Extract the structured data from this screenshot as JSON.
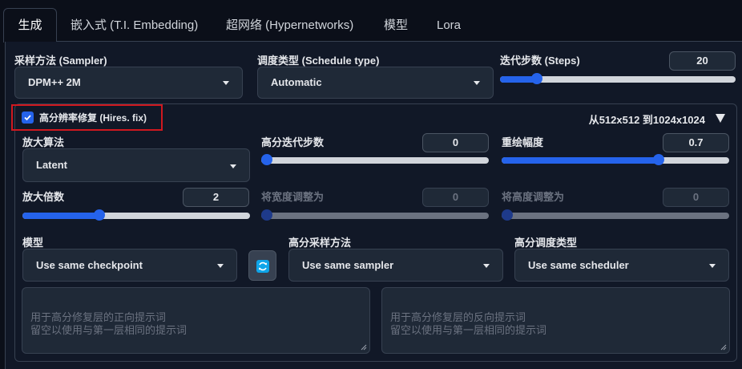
{
  "tabs": [
    {
      "label": "生成",
      "active": true
    },
    {
      "label": "嵌入式 (T.I. Embedding)"
    },
    {
      "label": "超网络 (Hypernetworks)"
    },
    {
      "label": "模型"
    },
    {
      "label": "Lora"
    }
  ],
  "sampler": {
    "label": "采样方法 (Sampler)",
    "value": "DPM++ 2M"
  },
  "schedule": {
    "label": "调度类型 (Schedule type)",
    "value": "Automatic"
  },
  "steps": {
    "label": "迭代步数 (Steps)",
    "value": "20",
    "fraction": 0.14
  },
  "hires": {
    "checkbox_label": "高分辨率修复 (Hires. fix)",
    "checked": true,
    "resolution_info": "从512x512 到1024x1024",
    "upscaler": {
      "label": "放大算法",
      "value": "Latent"
    },
    "hires_steps": {
      "label": "高分迭代步数",
      "value": "0",
      "fraction": 0.0
    },
    "denoising": {
      "label": "重绘幅度",
      "value": "0.7",
      "fraction": 0.7
    },
    "upscale_by": {
      "label": "放大倍数",
      "value": "2",
      "fraction": 0.33
    },
    "resize_width": {
      "label": "将宽度调整为",
      "value": "0",
      "fraction": 0.0
    },
    "resize_height": {
      "label": "将高度调整为",
      "value": "0",
      "fraction": 0.0
    },
    "checkpoint": {
      "label": "模型",
      "value": "Use same checkpoint"
    },
    "hires_sampler": {
      "label": "高分采样方法",
      "value": "Use same sampler"
    },
    "hires_scheduler": {
      "label": "高分调度类型",
      "value": "Use same scheduler"
    },
    "positive_prompt_placeholder": "用于高分修复层的正向提示词\n留空以使用与第一层相同的提示词",
    "negative_prompt_placeholder": "用于高分修复层的反向提示词\n留空以使用与第一层相同的提示词"
  },
  "colors": {
    "accent": "#2563eb",
    "highlight_box": "#d0181f",
    "background": "#0b0f19",
    "panel": "#111827"
  }
}
